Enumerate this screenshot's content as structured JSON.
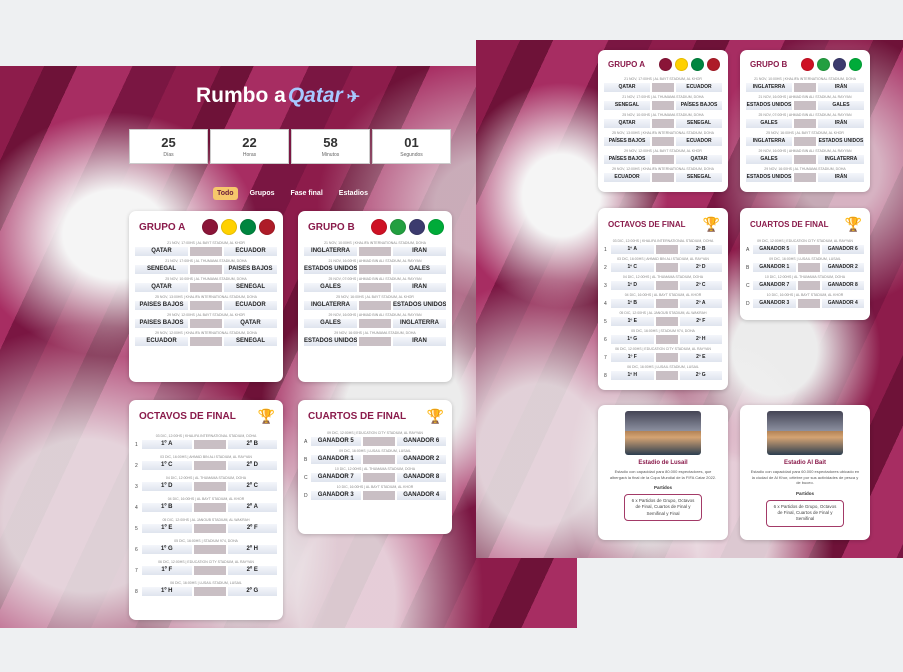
{
  "hero": {
    "title_a": "Rumbo a",
    "title_b": "Qatar",
    "plane": "✈"
  },
  "countdown": [
    {
      "value": "25",
      "label": "Días"
    },
    {
      "value": "22",
      "label": "Horas"
    },
    {
      "value": "58",
      "label": "Minutos"
    },
    {
      "value": "01",
      "label": "Segundos"
    }
  ],
  "filters": [
    "Todo",
    "Grupos",
    "Fase final",
    "Estadios"
  ],
  "group_a": {
    "title": "GRUPO A",
    "flags": [
      "#8a1538",
      "#ffd100",
      "#00853f",
      "#ae1c28"
    ],
    "matches": [
      {
        "meta": "21 NOV, 17:00HS | AL BAYT STADIUM, AL KHOR",
        "home": "QATAR",
        "away": "ECUADOR"
      },
      {
        "meta": "21 NOV, 17:00HS | AL THUMAMA STADIUM, DOHA",
        "home": "SENEGAL",
        "away": "PAÍSES BAJOS"
      },
      {
        "meta": "25 NOV, 10:00HS | AL THUMAMA STADIUM, DOHA",
        "home": "QATAR",
        "away": "SENEGAL"
      },
      {
        "meta": "25 NOV, 13:00HS | KHALIFA INTERNATIONAL STADIUM, DOHA",
        "home": "PAÍSES BAJOS",
        "away": "ECUADOR"
      },
      {
        "meta": "29 NOV, 12:00HS | AL BAYT STADIUM, AL KHOR",
        "home": "PAÍSES BAJOS",
        "away": "QATAR"
      },
      {
        "meta": "29 NOV, 12:00HS | KHALIFA INTERNATIONAL STADIUM, DOHA",
        "home": "ECUADOR",
        "away": "SENEGAL"
      }
    ]
  },
  "group_b": {
    "title": "GRUPO B",
    "flags": [
      "#ce1124",
      "#239f40",
      "#3c3b6e",
      "#00ab39"
    ],
    "matches": [
      {
        "meta": "21 NOV, 10:00HS | KHALIFA INTERNATIONAL STADIUM, DOHA",
        "home": "INGLATERRA",
        "away": "IRÁN"
      },
      {
        "meta": "21 NOV, 16:00HS | AHMAD BIN ALI STADIUM, AL RAYYAN",
        "home": "ESTADOS UNIDOS",
        "away": "GALES"
      },
      {
        "meta": "25 NOV, 07:00HS | AHMAD BIN ALI STADIUM, AL RAYYAN",
        "home": "GALES",
        "away": "IRÁN"
      },
      {
        "meta": "25 NOV, 16:00HS | AL BAYT STADIUM, AL KHOR",
        "home": "INGLATERRA",
        "away": "ESTADOS UNIDOS"
      },
      {
        "meta": "29 NOV, 16:00HS | AHMAD BIN ALI STADIUM, AL RAYYAN",
        "home": "GALES",
        "away": "INGLATERRA"
      },
      {
        "meta": "29 NOV, 16:00HS | AL THUMAMA STADIUM, DOHA",
        "home": "ESTADOS UNIDOS",
        "away": "IRÁN"
      }
    ]
  },
  "octavos": {
    "title": "OCTAVOS DE FINAL",
    "matches": [
      {
        "n": "1",
        "meta": "03 DIC, 12:00HS | KHALIFA INTERNATIONAL STADIUM, DOHA",
        "home": "1º A",
        "away": "2º B"
      },
      {
        "n": "2",
        "meta": "03 DIC, 16:00HS | AHMAD BIN ALI STADIUM, AL RAYYAN",
        "home": "1º C",
        "away": "2º D"
      },
      {
        "n": "3",
        "meta": "04 DIC, 12:00HS | AL THUMAMA STADIUM, DOHA",
        "home": "1º D",
        "away": "2º C"
      },
      {
        "n": "4",
        "meta": "04 DIC, 16:00HS | AL BAYT STADIUM, AL KHOR",
        "home": "1º B",
        "away": "2º A"
      },
      {
        "n": "5",
        "meta": "05 DIC, 12:00HS | AL JANOUB STADIUM, AL WAKRAH",
        "home": "1º E",
        "away": "2º F"
      },
      {
        "n": "6",
        "meta": "05 DIC, 16:00HS | STADIUM 974, DOHA",
        "home": "1º G",
        "away": "2º H"
      },
      {
        "n": "7",
        "meta": "06 DIC, 12:00HS | EDUCATION CITY STADIUM, AL RAYYAN",
        "home": "1º F",
        "away": "2º E"
      },
      {
        "n": "8",
        "meta": "06 DIC, 16:00HS | LUSAIL STADIUM, LUSAIL",
        "home": "1º H",
        "away": "2º G"
      }
    ]
  },
  "cuartos": {
    "title": "CUARTOS DE FINAL",
    "matches": [
      {
        "n": "A",
        "meta": "09 DIC, 12:00HS | EDUCATION CITY STADIUM, AL RAYYAN",
        "home": "GANADOR 5",
        "away": "GANADOR 6"
      },
      {
        "n": "B",
        "meta": "09 DIC, 16:00HS | LUSAIL STADIUM, LUSAIL",
        "home": "GANADOR 1",
        "away": "GANADOR 2"
      },
      {
        "n": "C",
        "meta": "10 DIC, 12:00HS | AL THUMAMA STADIUM, DOHA",
        "home": "GANADOR 7",
        "away": "GANADOR 8"
      },
      {
        "n": "D",
        "meta": "10 DIC, 16:00HS | AL BAYT STADIUM, AL KHOR",
        "home": "GANADOR 3",
        "away": "GANADOR 4"
      }
    ]
  },
  "stadiums": [
    {
      "name": "Estadio de Lusail",
      "desc": "Estadio con capacidad para 80.000 espectadores, que albergará la final de la Copa Mundial de la FIFA Catar 2022.",
      "label": "Partidos",
      "matches": "6 x Partidos de Grupo, Octavos de Final, Cuartos de Final y Semifinal y Final"
    },
    {
      "name": "Estadio Al Bait",
      "desc": "Estadio con capacidad para 60.000 espectadores ubicado en la ciudad de Al Khor, célebre por sus actividades de pesca y de buceo.",
      "label": "Partidos",
      "matches": "6 x Partidos de Grupo, Octavos de Final, Cuartos de Final y Semifinal"
    }
  ]
}
